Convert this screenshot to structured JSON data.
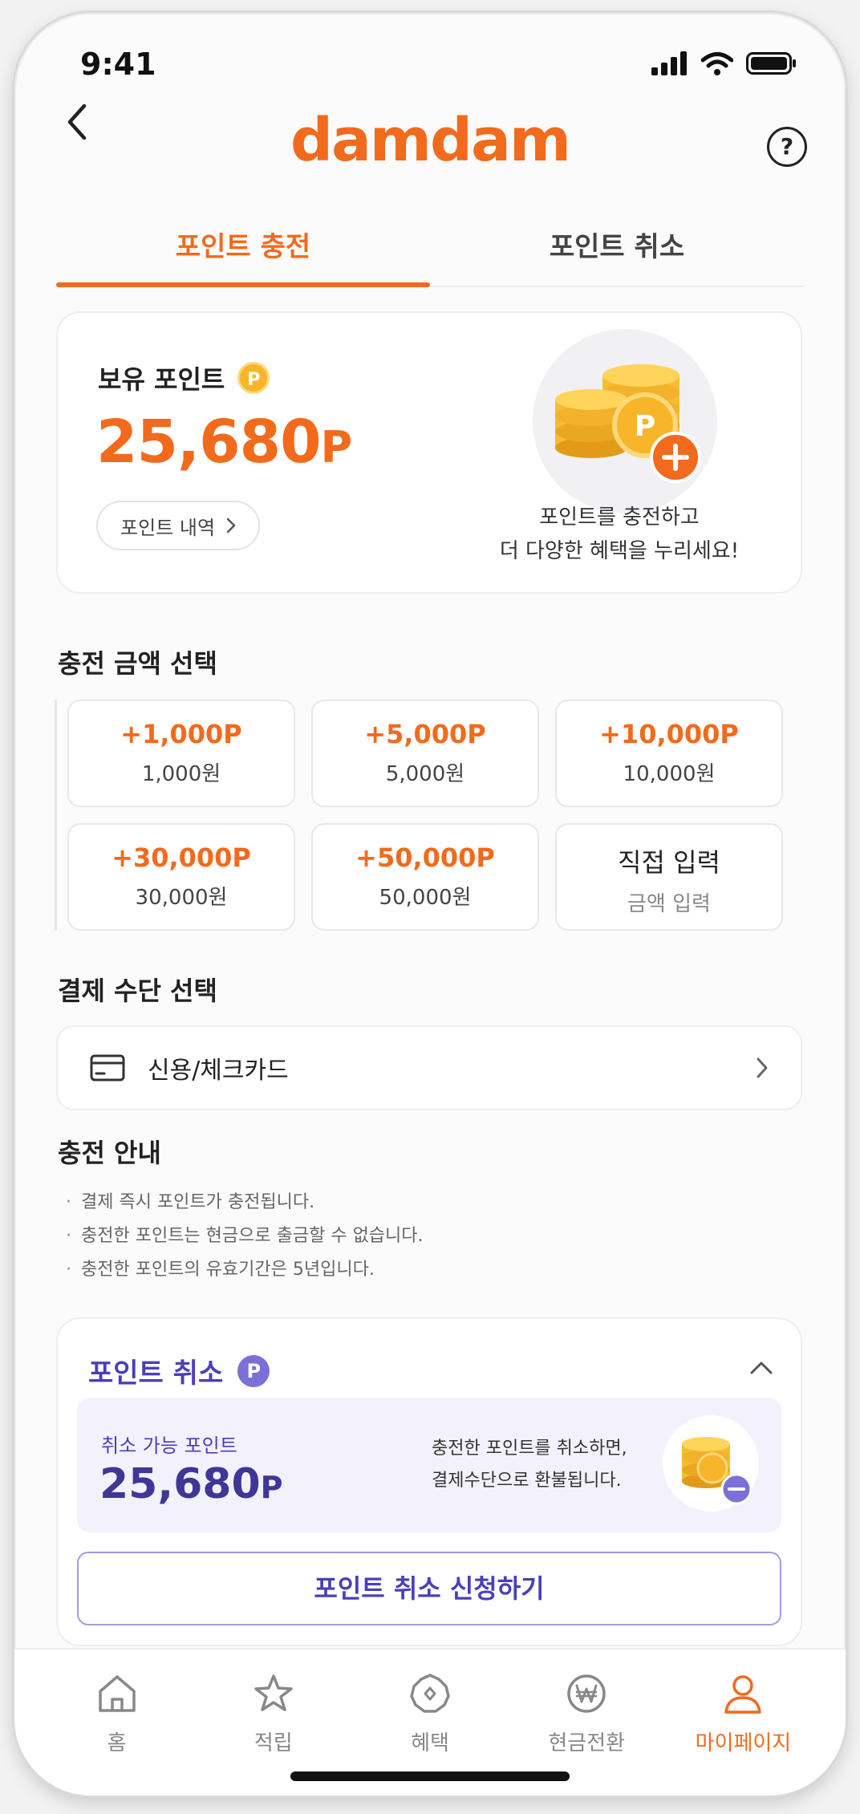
{
  "status_bar": {
    "time": "9:41"
  },
  "header": {
    "logo": "damdam",
    "help_symbol": "?"
  },
  "tabs": [
    {
      "label": "포인트 충전",
      "active": true
    },
    {
      "label": "포인트 취소",
      "active": false
    }
  ],
  "balance": {
    "label": "보유 포인트",
    "badge": "P",
    "amount": "25,680",
    "unit": "P",
    "history_label": "포인트 내역",
    "promo_line1": "포인트를 충전하고",
    "promo_line2": "더 다양한 혜택을 누리세요!"
  },
  "charge": {
    "title": "충전 금액 선택",
    "options": [
      {
        "points": "+1,000P",
        "price": "1,000원"
      },
      {
        "points": "+5,000P",
        "price": "5,000원"
      },
      {
        "points": "+10,000P",
        "price": "10,000원"
      },
      {
        "points": "+30,000P",
        "price": "30,000원"
      },
      {
        "points": "+50,000P",
        "price": "50,000원"
      },
      {
        "points": "직접 입력",
        "price": "금액 입력"
      }
    ]
  },
  "payment": {
    "title": "결제 수단 선택",
    "method": "신용/체크카드"
  },
  "guide": {
    "title": "충전 안내",
    "items": [
      "결제 즉시 포인트가 충전됩니다.",
      "충전한 포인트는 현금으로 출금할 수 없습니다.",
      "충전한 포인트의 유효기간은 5년입니다."
    ]
  },
  "cancel": {
    "title": "포인트 취소",
    "badge": "P",
    "available_label": "취소 가능 포인트",
    "amount": "25,680",
    "unit": "P",
    "desc_line1": "충전한 포인트를 취소하면,",
    "desc_line2": "결제수단으로 환불됩니다.",
    "button_label": "포인트 취소 신청하기"
  },
  "bottom_nav": [
    {
      "label": "홈",
      "icon": "home-icon",
      "active": false
    },
    {
      "label": "적립",
      "icon": "star-icon",
      "active": false
    },
    {
      "label": "혜택",
      "icon": "benefit-icon",
      "active": false
    },
    {
      "label": "현금전환",
      "icon": "won-icon",
      "active": false
    },
    {
      "label": "마이페이지",
      "icon": "person-icon",
      "active": true
    }
  ],
  "colors": {
    "accent": "#f26a1c",
    "purple": "#4b3fb8",
    "coin": "#f7b52a"
  }
}
